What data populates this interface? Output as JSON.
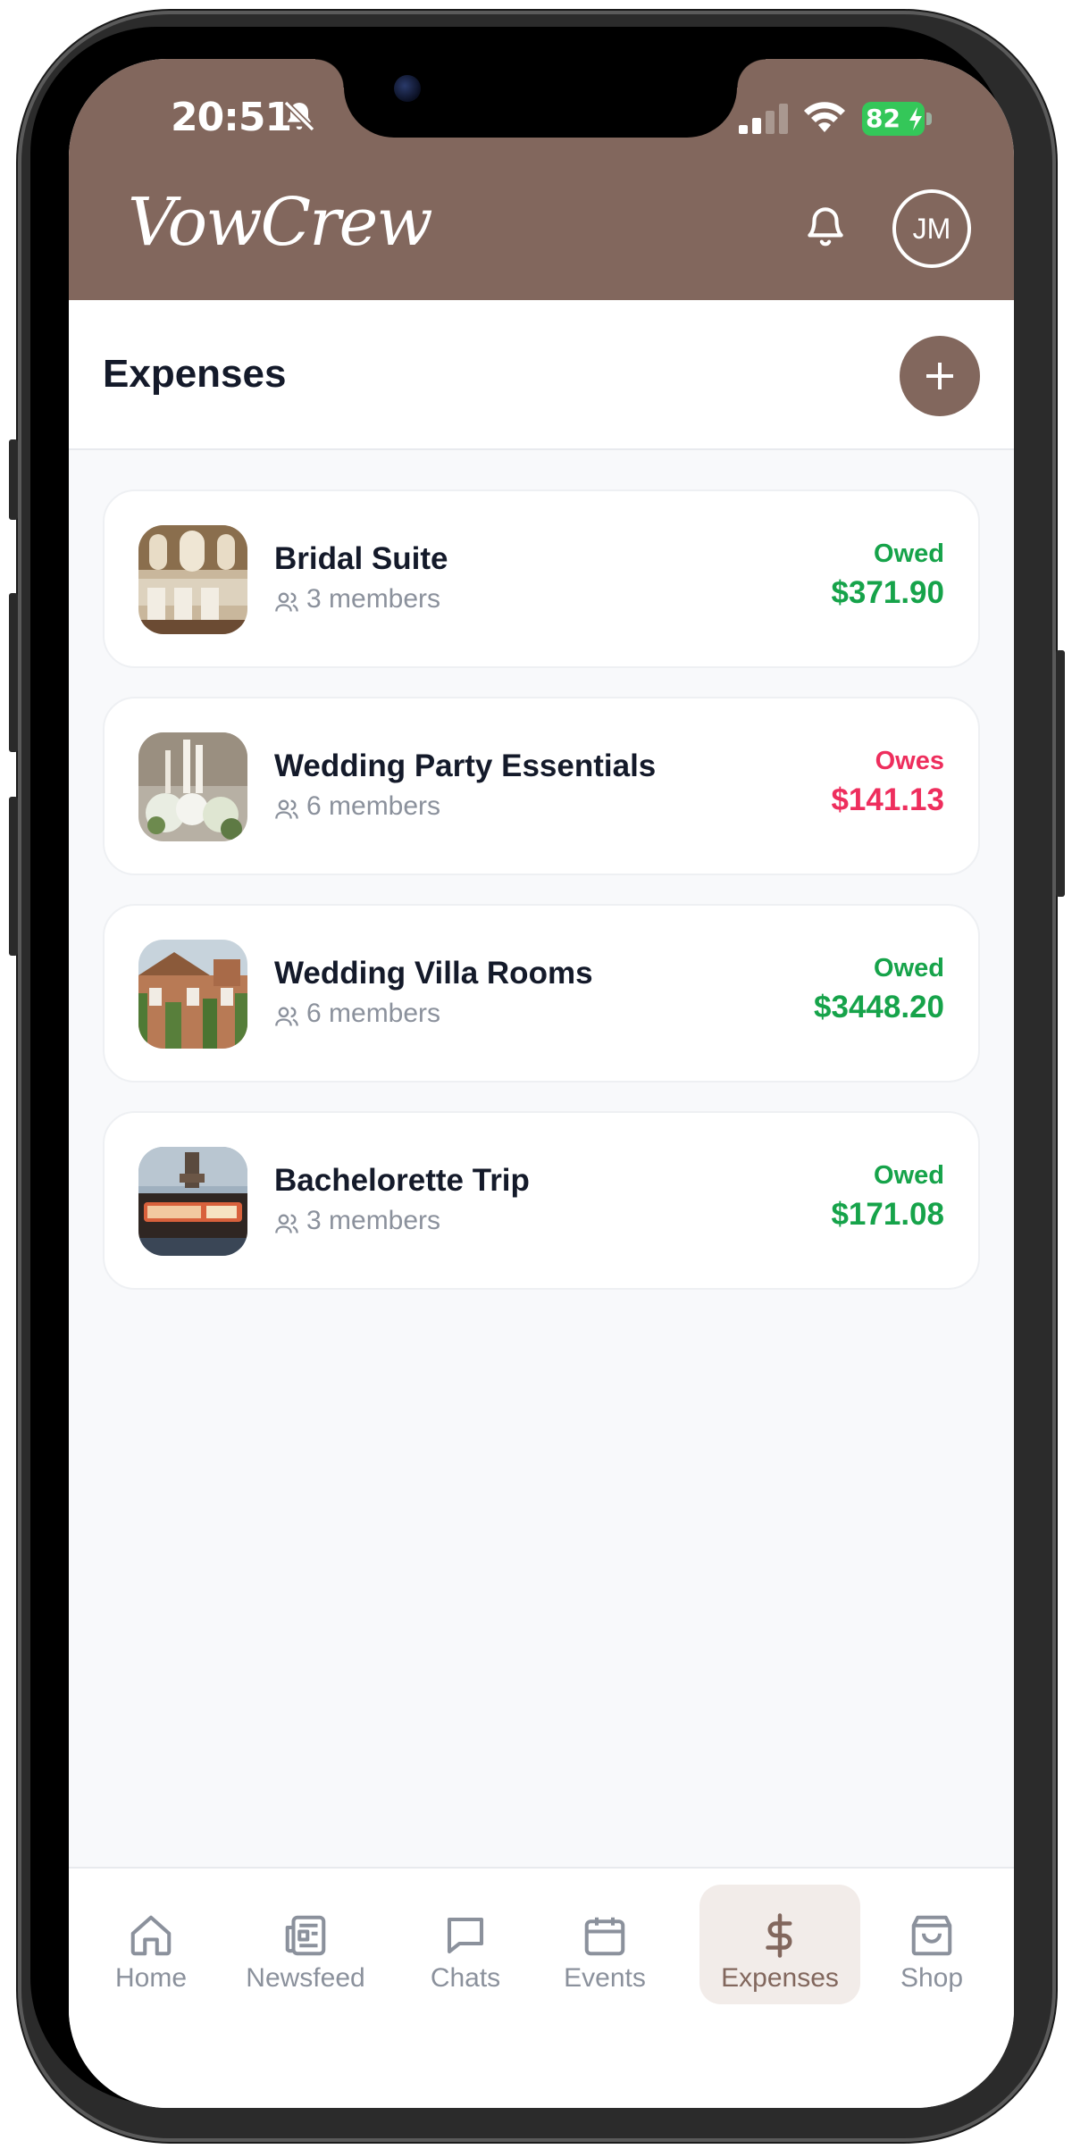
{
  "status_bar": {
    "time": "20:51",
    "battery": "82"
  },
  "header": {
    "logo": "VowCrew",
    "avatar_initials": "JM"
  },
  "page": {
    "title": "Expenses"
  },
  "expenses": [
    {
      "name": "Bridal Suite",
      "members": "3 members",
      "status": "Owed",
      "amount": "$371.90",
      "status_color": "#16a34a"
    },
    {
      "name": "Wedding Party Essentials",
      "members": "6 members",
      "status": "Owes",
      "amount": "$141.13",
      "status_color": "#ee2e5d"
    },
    {
      "name": "Wedding Villa Rooms",
      "members": "6 members",
      "status": "Owed",
      "amount": "$3448.20",
      "status_color": "#16a34a"
    },
    {
      "name": "Bachelorette Trip",
      "members": "3 members",
      "status": "Owed",
      "amount": "$171.08",
      "status_color": "#16a34a"
    }
  ],
  "nav": {
    "items": [
      {
        "label": "Home",
        "icon": "home-icon"
      },
      {
        "label": "Newsfeed",
        "icon": "newspaper-icon"
      },
      {
        "label": "Chats",
        "icon": "chat-icon"
      },
      {
        "label": "Events",
        "icon": "calendar-icon"
      },
      {
        "label": "Expenses",
        "icon": "dollar-icon",
        "active": true
      },
      {
        "label": "Shop",
        "icon": "shopping-bag-icon"
      }
    ]
  },
  "colors": {
    "brand": "#82675d",
    "owed": "#16a34a",
    "owes": "#ee2e5d"
  }
}
